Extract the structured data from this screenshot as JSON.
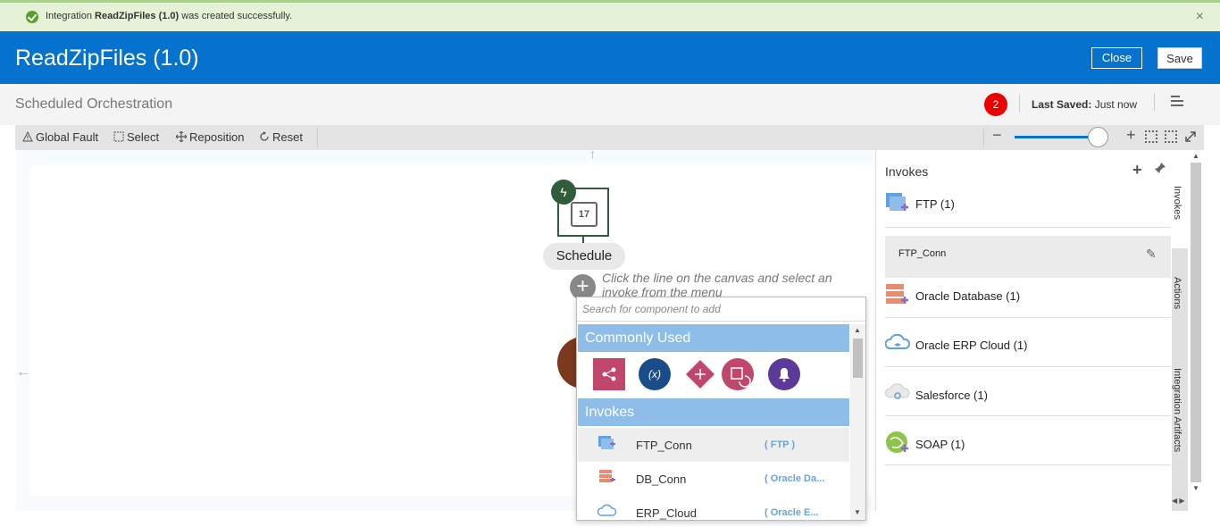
{
  "notification": {
    "prefix": "Integration ",
    "name": "ReadZipFiles (1.0)",
    "suffix": " was created successfully.",
    "close": "×"
  },
  "header": {
    "title": "ReadZipFiles (1.0)",
    "close_label": "Close",
    "save_label": "Save"
  },
  "subheader": {
    "type": "Scheduled Orchestration",
    "badge_count": "2",
    "last_saved_label": "Last Saved:",
    "last_saved_value": " Just now"
  },
  "toolbar": {
    "global_fault": "Global Fault",
    "select": "Select",
    "reposition": "Reposition",
    "reset": "Reset",
    "zoom_minus": "−",
    "zoom_plus": "+",
    "zoom_level": 0.87
  },
  "canvas": {
    "schedule_day": "17",
    "schedule_label": "Schedule",
    "hint": "Click the line on the canvas and select an invoke from the menu"
  },
  "popup": {
    "search_placeholder": "Search for component to add",
    "commonly_used_header": "Commonly Used",
    "commonly_used_icons": [
      "map-icon",
      "assign-variable-icon",
      "switch-icon",
      "for-each-icon",
      "notification-icon"
    ],
    "commonly_used_glyphs": [
      "⇶",
      "(x)",
      "◆",
      "⟳",
      "🔔"
    ],
    "invokes_header": "Invokes",
    "invokes": [
      {
        "name": "FTP_Conn",
        "type": "( FTP )",
        "icon": "ftp-adapter-icon"
      },
      {
        "name": "DB_Conn",
        "type": "( Oracle Da...",
        "icon": "oracle-database-icon"
      },
      {
        "name": "ERP_Cloud",
        "type": "( Oracle E...",
        "icon": "erp-cloud-icon"
      }
    ]
  },
  "right_panel": {
    "title": "Invokes",
    "items": [
      {
        "label": "FTP (1)",
        "icon": "ftp-adapter-icon"
      },
      {
        "label": "FTP_Conn",
        "icon": "edit-icon"
      },
      {
        "label": "Oracle Database (1)",
        "icon": "oracle-database-icon"
      },
      {
        "label": "Oracle ERP Cloud (1)",
        "icon": "erp-cloud-icon"
      },
      {
        "label": "Salesforce (1)",
        "icon": "salesforce-icon"
      },
      {
        "label": "SOAP (1)",
        "icon": "soap-icon"
      }
    ],
    "tabs": [
      "Invokes",
      "Actions",
      "Integration Artifacts"
    ]
  },
  "colors": {
    "brand": "#0572ce",
    "success": "#5a9e2f",
    "popup_header": "#8dbde8",
    "error_badge": "#e00000"
  }
}
